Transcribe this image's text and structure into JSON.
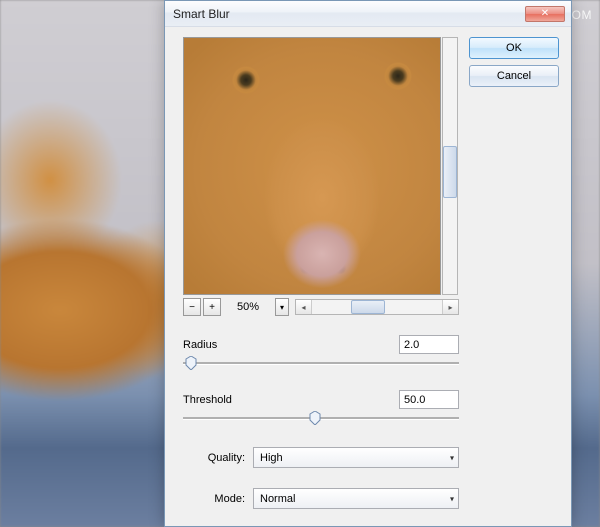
{
  "watermark": "思缘设计论坛  WWW.MISSYUAN.COM",
  "dialog": {
    "title": "Smart Blur",
    "buttons": {
      "ok": "OK",
      "cancel": "Cancel"
    },
    "zoom": {
      "value": "50%",
      "minus": "−",
      "plus": "+"
    },
    "radius": {
      "label": "Radius",
      "value": "2.0",
      "position_pct": 3
    },
    "threshold": {
      "label": "Threshold",
      "value": "50.0",
      "position_pct": 48
    },
    "quality": {
      "label": "Quality:",
      "value": "High"
    },
    "mode": {
      "label": "Mode:",
      "value": "Normal"
    }
  }
}
